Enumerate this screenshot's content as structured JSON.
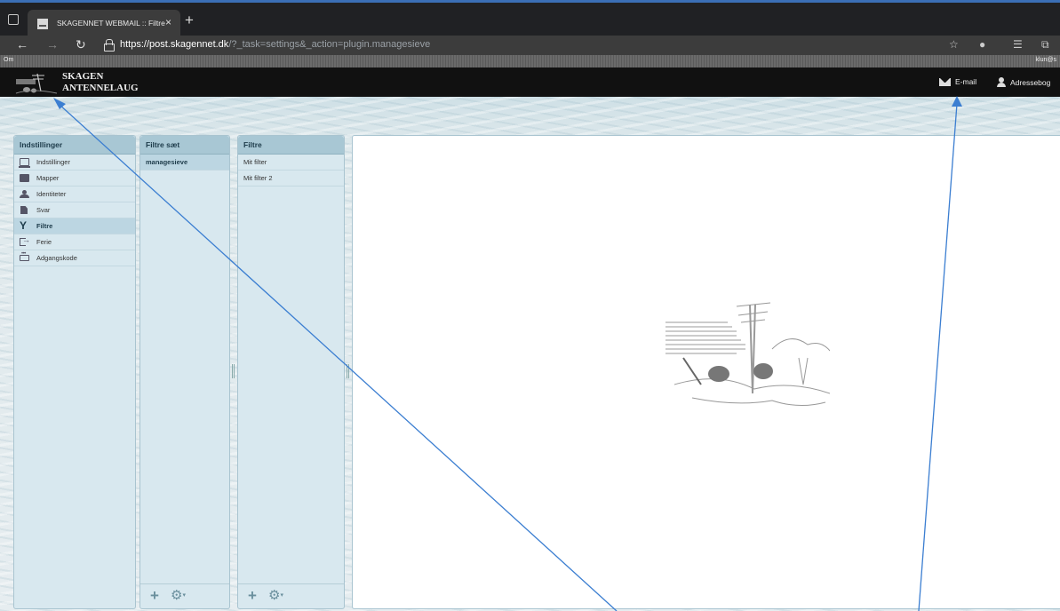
{
  "browser": {
    "tab_title": "SKAGENNET WEBMAIL :: Filtre",
    "tab_close": "×",
    "new_tab": "+",
    "url_scheme_host": "https://post.skagennet.dk",
    "url_rest": "/?_task=settings&_action=plugin.managesieve",
    "icons": [
      "tab-actions-icon",
      "back-icon",
      "forward-icon",
      "reload-icon",
      "lock-icon",
      "favorite-icon",
      "extension-icon",
      "favorites-bar-icon",
      "collections-icon"
    ]
  },
  "topline": {
    "about": "Om",
    "user": "klun@s"
  },
  "logo": {
    "line1": "SKAGEN",
    "line2": "ANTENNELAUG"
  },
  "header_nav": {
    "email": "E-mail",
    "addressbook": "Adressebog"
  },
  "settings_panel": {
    "title": "Indstillinger",
    "items": [
      {
        "label": "Indstillinger",
        "icon": "monitor-icon"
      },
      {
        "label": "Mapper",
        "icon": "folder-icon"
      },
      {
        "label": "Identiteter",
        "icon": "user-icon"
      },
      {
        "label": "Svar",
        "icon": "document-icon"
      },
      {
        "label": "Filtre",
        "icon": "filter-icon",
        "selected": true
      },
      {
        "label": "Ferie",
        "icon": "exit-icon"
      },
      {
        "label": "Adgangskode",
        "icon": "password-icon"
      }
    ]
  },
  "filtersets_panel": {
    "title": "Filtre sæt",
    "items": [
      "managesieve"
    ]
  },
  "filters_panel": {
    "title": "Filtre",
    "items": [
      "Mit filter",
      "Mit filter 2"
    ]
  },
  "footer_buttons": {
    "add": "+",
    "gear": "⚙"
  },
  "colors": {
    "accent": "#3b7ed1",
    "panel_header": "#a8c7d4",
    "panel_bg": "#d8e8ef"
  }
}
